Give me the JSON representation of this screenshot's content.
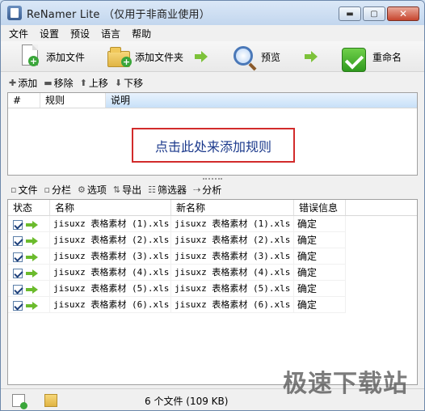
{
  "window": {
    "title": "ReNamer Lite （仅用于非商业使用）",
    "buttons": {
      "minimize": "▬",
      "maximize": "▢",
      "close": "✕"
    }
  },
  "menu": [
    "文件",
    "设置",
    "预设",
    "语言",
    "帮助"
  ],
  "toolbar": {
    "add_files": "添加文件",
    "add_folder": "添加文件夹",
    "preview": "预览",
    "rename": "重命名"
  },
  "rules_toolbar": {
    "add": "添加",
    "remove": "移除",
    "up": "上移",
    "down": "下移"
  },
  "rules_table": {
    "columns": [
      "#",
      "规则",
      "说明"
    ],
    "empty_hint": "点击此处来添加规则"
  },
  "files_toolbar": {
    "files": "文件",
    "columns": "分栏",
    "options": "选项",
    "export": "导出",
    "filter": "筛选器",
    "analyze": "分析"
  },
  "files_table": {
    "columns": [
      "状态",
      "名称",
      "新名称",
      "错误信息"
    ],
    "rows": [
      {
        "name": "jisuxz 表格素材 (1).xls",
        "new_name": "jisuxz 表格素材 (1).xls",
        "error": "确定"
      },
      {
        "name": "jisuxz 表格素材 (2).xls",
        "new_name": "jisuxz 表格素材 (2).xls",
        "error": "确定"
      },
      {
        "name": "jisuxz 表格素材 (3).xls",
        "new_name": "jisuxz 表格素材 (3).xls",
        "error": "确定"
      },
      {
        "name": "jisuxz 表格素材 (4).xls",
        "new_name": "jisuxz 表格素材 (4).xls",
        "error": "确定"
      },
      {
        "name": "jisuxz 表格素材 (5).xls",
        "new_name": "jisuxz 表格素材 (5).xls",
        "error": "确定"
      },
      {
        "name": "jisuxz 表格素材 (6).xls",
        "new_name": "jisuxz 表格素材 (6).xls",
        "error": "确定"
      }
    ]
  },
  "status": {
    "text": "6 个文件 (109 KB)"
  },
  "watermark": "极速下载站"
}
